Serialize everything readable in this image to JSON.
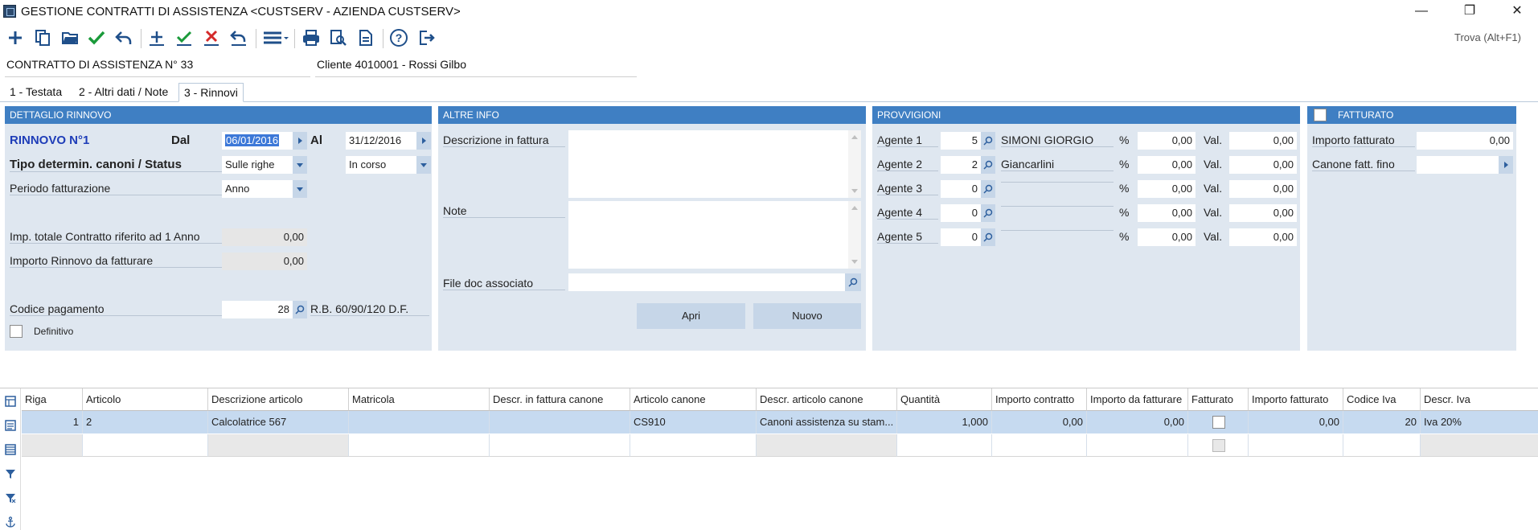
{
  "window": {
    "title": "GESTIONE CONTRATTI DI ASSISTENZA <CUSTSERV - AZIENDA CUSTSERV>",
    "minimize": "—",
    "restore": "❐",
    "close": "✕"
  },
  "toolbar": {
    "find_label": "Trova (Alt+F1)"
  },
  "header": {
    "contract": "CONTRATTO DI ASSISTENZA N° 33",
    "client": "Cliente 4010001 - Rossi Gilbo"
  },
  "tabs": [
    {
      "label": "1 - Testata"
    },
    {
      "label": "2 - Altri dati / Note"
    },
    {
      "label": "3 - Rinnovi"
    }
  ],
  "dettaglio": {
    "title": "DETTAGLIO RINNOVO",
    "rinnovo": "RINNOVO N°1",
    "dal_label": "Dal",
    "dal_value": "06/01/2016",
    "al_label": "Al",
    "al_value": "31/12/2016",
    "tipo_label": "Tipo determin. canoni / Status",
    "tipo_value": "Sulle righe",
    "status_value": "In corso",
    "periodo_label": "Periodo fatturazione",
    "periodo_value": "Anno",
    "imp_totale_label": "Imp. totale Contratto riferito ad 1 Anno",
    "imp_totale_value": "0,00",
    "importo_rinnovo_label": "Importo Rinnovo da fatturare",
    "importo_rinnovo_value": "0,00",
    "codice_pag_label": "Codice pagamento",
    "codice_pag_value": "28",
    "codice_pag_desc": "R.B. 60/90/120 D.F.",
    "definitivo_label": "Definitivo"
  },
  "altre_info": {
    "title": "ALTRE INFO",
    "descrizione_label": "Descrizione in fattura",
    "note_label": "Note",
    "file_label": "File doc associato",
    "apri_label": "Apri",
    "nuovo_label": "Nuovo"
  },
  "provvigioni": {
    "title": "PROVVIGIONI",
    "rows": [
      {
        "label": "Agente 1",
        "code": "5",
        "name": "SIMONI GIORGIO",
        "pct_label": "%",
        "pct": "0,00",
        "val_label": "Val.",
        "val": "0,00"
      },
      {
        "label": "Agente 2",
        "code": "2",
        "name": "Giancarlini",
        "pct_label": "%",
        "pct": "0,00",
        "val_label": "Val.",
        "val": "0,00"
      },
      {
        "label": "Agente 3",
        "code": "0",
        "name": "",
        "pct_label": "%",
        "pct": "0,00",
        "val_label": "Val.",
        "val": "0,00"
      },
      {
        "label": "Agente 4",
        "code": "0",
        "name": "",
        "pct_label": "%",
        "pct": "0,00",
        "val_label": "Val.",
        "val": "0,00"
      },
      {
        "label": "Agente 5",
        "code": "0",
        "name": "",
        "pct_label": "%",
        "pct": "0,00",
        "val_label": "Val.",
        "val": "0,00"
      }
    ]
  },
  "fatturato": {
    "title": "FATTURATO",
    "importo_label": "Importo fatturato",
    "importo_value": "0,00",
    "canone_label": "Canone fatt. fino",
    "canone_value": ""
  },
  "grid": {
    "columns": [
      "Riga",
      "Articolo",
      "Descrizione articolo",
      "Matricola",
      "Descr. in fattura canone",
      "Articolo canone",
      "Descr. articolo canone",
      "Quantità",
      "Importo contratto",
      "Importo da fatturare",
      "Fatturato",
      "Importo fatturato",
      "Codice Iva",
      "Descr. Iva"
    ],
    "rows": [
      {
        "riga": "1",
        "articolo": "2",
        "descrizione": "Calcolatrice 567",
        "matricola": "",
        "descr_fattura": "",
        "articolo_canone": "CS910",
        "descr_canone": "Canoni assistenza su stam...",
        "quantita": "1,000",
        "importo_contratto": "0,00",
        "importo_da_fatturare": "0,00",
        "fatturato": false,
        "importo_fatturato": "0,00",
        "codice_iva": "20",
        "descr_iva": "Iva 20%"
      }
    ]
  }
}
